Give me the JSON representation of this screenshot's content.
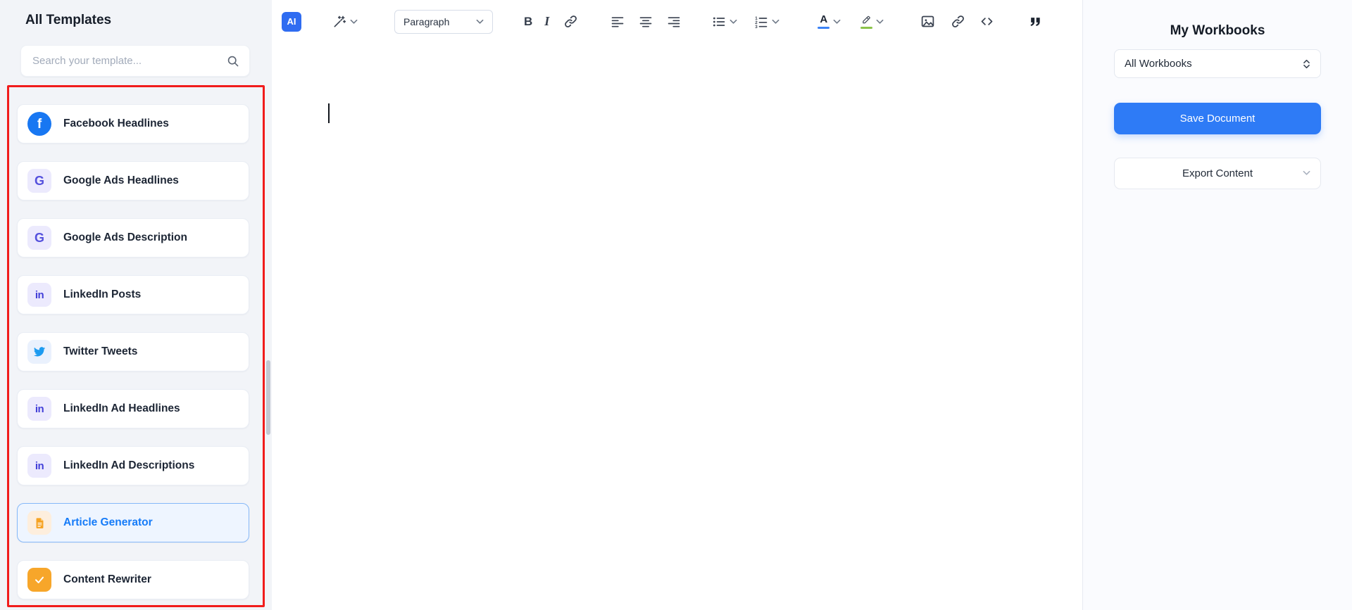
{
  "sidebar": {
    "title": "All Templates",
    "search": {
      "placeholder": "Search your template..."
    },
    "templates": [
      {
        "label": "Facebook Headlines",
        "icon": "facebook"
      },
      {
        "label": "Google Ads Headlines",
        "icon": "google"
      },
      {
        "label": "Google Ads Description",
        "icon": "google"
      },
      {
        "label": "LinkedIn Posts",
        "icon": "linkedin"
      },
      {
        "label": "Twitter Tweets",
        "icon": "twitter"
      },
      {
        "label": "LinkedIn Ad Headlines",
        "icon": "linkedin"
      },
      {
        "label": "LinkedIn Ad Descriptions",
        "icon": "linkedin"
      },
      {
        "label": "Article Generator",
        "icon": "article",
        "selected": true
      },
      {
        "label": "Content Rewriter",
        "icon": "rewriter"
      }
    ],
    "icon_glyphs": {
      "facebook": "f",
      "google": "G",
      "linkedin": "in"
    }
  },
  "toolbar": {
    "ai_label": "AI",
    "paragraph_label": "Paragraph",
    "bold_label": "B",
    "italic_label": "I",
    "text_color_label": "A"
  },
  "workbooks": {
    "title": "My Workbooks",
    "selected_workbook": "All Workbooks",
    "save_label": "Save Document",
    "export_label": "Export Content"
  },
  "editor": {
    "content": ""
  },
  "colors": {
    "accent_blue": "#2e7bf6",
    "selected_template_text": "#157bf8",
    "annotation_red": "#f11c1c",
    "facebook_blue": "#1877f2",
    "twitter_blue": "#1d9bf0"
  }
}
